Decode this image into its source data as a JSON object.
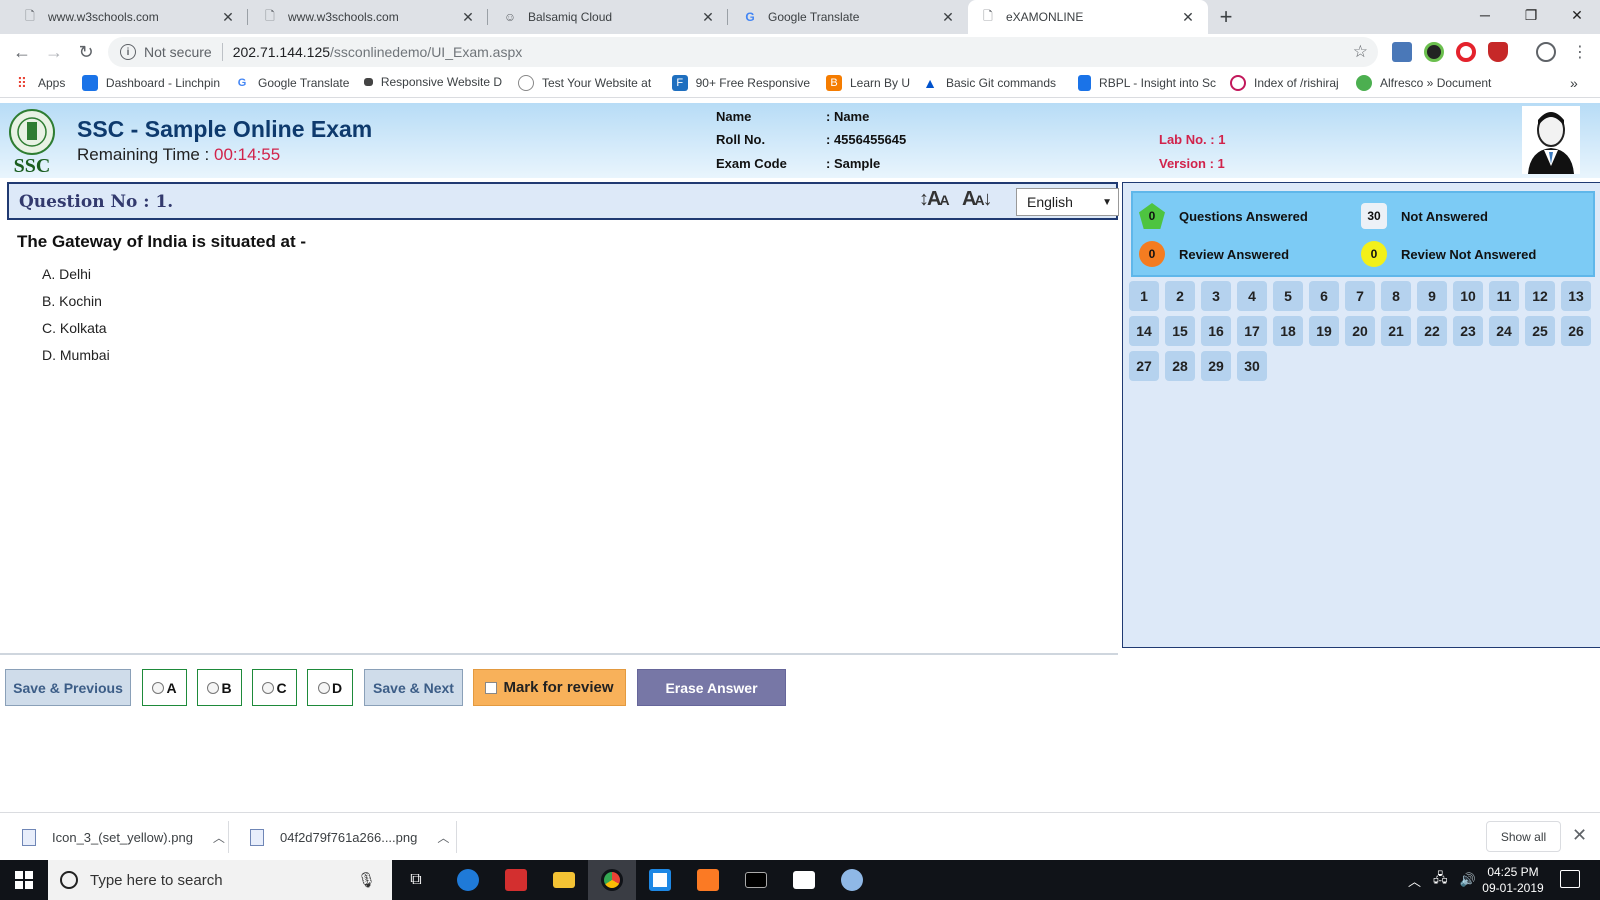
{
  "browser": {
    "tabs": [
      {
        "label": "www.w3schools.com",
        "icon": "page-icon"
      },
      {
        "label": "www.w3schools.com",
        "icon": "page-icon"
      },
      {
        "label": "Balsamiq Cloud",
        "icon": "smiley-icon"
      },
      {
        "label": "Google Translate",
        "icon": "translate-icon"
      },
      {
        "label": "eXAMONLINE",
        "icon": "page-icon"
      }
    ],
    "address": {
      "security": "Not secure",
      "host": "202.71.144.125",
      "path": "/ssconlinedemo/UI_Exam.aspx"
    },
    "bookmarks": [
      {
        "label": "Apps",
        "color": "#ea4335"
      },
      {
        "label": "Dashboard - Linchpin",
        "color": "#1a73e8"
      },
      {
        "label": "Google Translate",
        "color": "#4285f4"
      },
      {
        "label": "Responsive Website D",
        "color": "#444444"
      },
      {
        "label": "Test Your Website at",
        "color": "#888888"
      },
      {
        "label": "90+ Free Responsive",
        "color": "#1f6fbf"
      },
      {
        "label": "Learn By U",
        "color": "#f57c00"
      },
      {
        "label": "Basic Git commands",
        "color": "#0052cc"
      },
      {
        "label": "RBPL - Insight into Sc",
        "color": "#1a73e8"
      },
      {
        "label": "Index of /rishiraj",
        "color": "#c2185b"
      },
      {
        "label": "Alfresco » Document",
        "color": "#4caf50"
      }
    ]
  },
  "exam": {
    "title": "SSC - Sample Online Exam",
    "remaining_label": "Remaining Time :",
    "remaining_time": "00:14:55",
    "candidate": {
      "name_label": "Name",
      "name_value": ": Name",
      "roll_label": "Roll No.",
      "roll_value": ": 4556455645",
      "code_label": "Exam Code",
      "code_value": ": Sample"
    },
    "lab": {
      "label": "Lab No. :",
      "value": "1"
    },
    "version": {
      "label": "Version :",
      "value": "1"
    },
    "question_no": "Question No : 1.",
    "language": "English",
    "question": "The Gateway of India is situated at -",
    "options": [
      "A. Delhi",
      "B. Kochin",
      "C. Kolkata",
      "D. Mumbai"
    ]
  },
  "legend": {
    "answered": {
      "count": "0",
      "label": "Questions Answered"
    },
    "not_answered": {
      "count": "30",
      "label": "Not Answered"
    },
    "review_answered": {
      "count": "0",
      "label": "Review Answered"
    },
    "review_not_answered": {
      "count": "0",
      "label": "Review Not Answered"
    }
  },
  "question_numbers": [
    "1",
    "2",
    "3",
    "4",
    "5",
    "6",
    "7",
    "8",
    "9",
    "10",
    "11",
    "12",
    "13",
    "14",
    "15",
    "16",
    "17",
    "18",
    "19",
    "20",
    "21",
    "22",
    "23",
    "24",
    "25",
    "26",
    "27",
    "28",
    "29",
    "30"
  ],
  "controls": {
    "save_previous": "Save & Previous",
    "opt_a": "A",
    "opt_b": "B",
    "opt_c": "C",
    "opt_d": "D",
    "save_next": "Save & Next",
    "mark_review": "Mark for review",
    "erase": "Erase Answer"
  },
  "downloads": {
    "file1": "Icon_3_(set_yellow).png",
    "file2": "04f2d79f761a266....png",
    "show_all": "Show all"
  },
  "taskbar": {
    "search_placeholder": "Type here to search",
    "time": "04:25 PM",
    "date": "09-01-2019"
  }
}
